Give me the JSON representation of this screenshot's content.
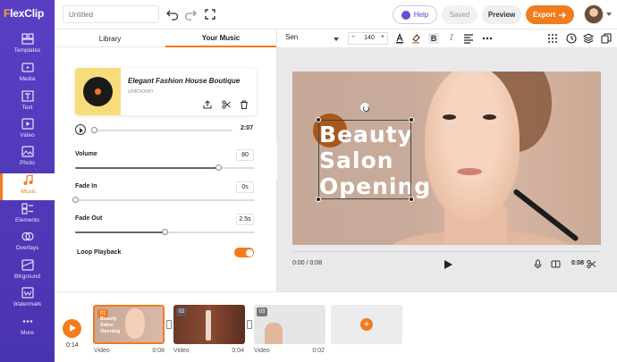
{
  "app": {
    "logo_prefix": "F",
    "logo_rest": "lexClip",
    "title_placeholder": "Untitled",
    "help_label": "Help",
    "saved_label": "Saved",
    "preview_label": "Preview",
    "export_label": "Export",
    "accent_color": "#f07c1e",
    "brand_color": "#5a3fc4"
  },
  "sidebar": {
    "items": [
      {
        "label": "Templates",
        "icon": "templates-icon"
      },
      {
        "label": "Media",
        "icon": "media-icon"
      },
      {
        "label": "Text",
        "icon": "text-icon"
      },
      {
        "label": "Video",
        "icon": "video-icon"
      },
      {
        "label": "Photo",
        "icon": "photo-icon"
      },
      {
        "label": "Music",
        "icon": "music-icon",
        "active": true
      },
      {
        "label": "Elements",
        "icon": "elements-icon"
      },
      {
        "label": "Overlays",
        "icon": "overlays-icon"
      },
      {
        "label": "BKground",
        "icon": "background-icon"
      },
      {
        "label": "Watermark",
        "icon": "watermark-icon"
      },
      {
        "label": "More",
        "icon": "more-icon"
      }
    ]
  },
  "panel": {
    "tabs": [
      "Library",
      "Your Music"
    ],
    "active_tab": "Your Music",
    "music": {
      "title": "Elegant Fashion House Boutique",
      "artist": "unknown",
      "duration": "2:07",
      "progress": 0.0
    },
    "volume": {
      "label": "Volume",
      "value": "80",
      "level": 0.8
    },
    "fade_in": {
      "label": "Fade In",
      "value": "0s",
      "level": 0.0
    },
    "fade_out": {
      "label": "Fade Out",
      "value": "2.5s",
      "level": 0.5
    },
    "loop": {
      "label": "Loop Playback",
      "enabled": true
    }
  },
  "text_toolbar": {
    "font": "Sen",
    "size": "140",
    "minus": "−",
    "plus": "+"
  },
  "canvas": {
    "headline": "Beauty\nSalon\nOpening",
    "current_time": "0:00 / 0:08",
    "total_time": "0:08"
  },
  "timeline": {
    "current_time": "0:14",
    "clips": [
      {
        "num": "01",
        "type": "Video",
        "duration": "0:08",
        "mini_text": "Beauty\nSalon\nOpening",
        "active": true
      },
      {
        "num": "02",
        "type": "Video",
        "duration": "0:04"
      },
      {
        "num": "03",
        "type": "Video",
        "duration": "0:02"
      }
    ],
    "add_label": "+"
  }
}
